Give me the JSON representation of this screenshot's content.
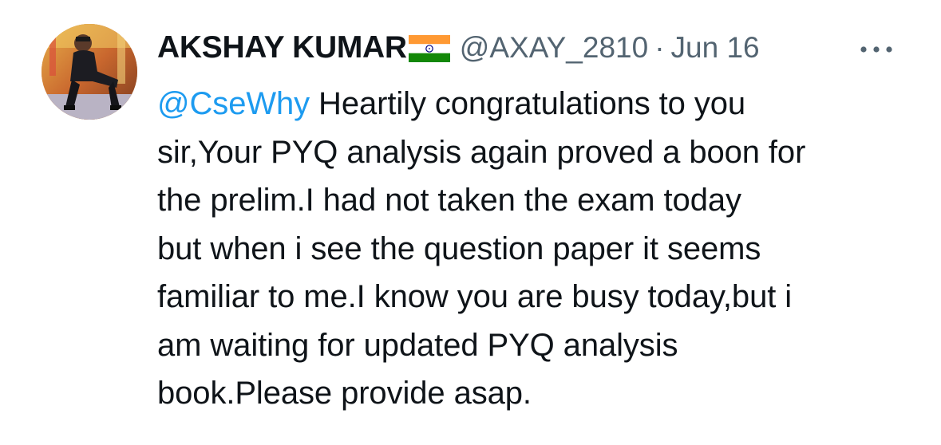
{
  "tweet": {
    "author": {
      "name": "AKSHAY KUMAR",
      "flag_emoji": "india-flag",
      "handle": "@AXAY_2810"
    },
    "separator": "·",
    "date": "Jun 16",
    "more_icon": "more-horizontal-icon",
    "mention": "@CseWhy",
    "lines": [
      " Heartily congratulations to you",
      "sir,Your PYQ analysis again proved a boon for",
      "the prelim.I had not taken the exam today",
      "but when i see the question paper it seems",
      "familiar to me.I know you are busy today,but i",
      "am waiting for updated PYQ analysis",
      "book.Please provide asap."
    ]
  },
  "colors": {
    "text": "#0f1419",
    "secondary": "#536471",
    "link": "#1d9bf0",
    "saffron": "#FF9933",
    "green": "#138808",
    "chakra": "#000080"
  }
}
